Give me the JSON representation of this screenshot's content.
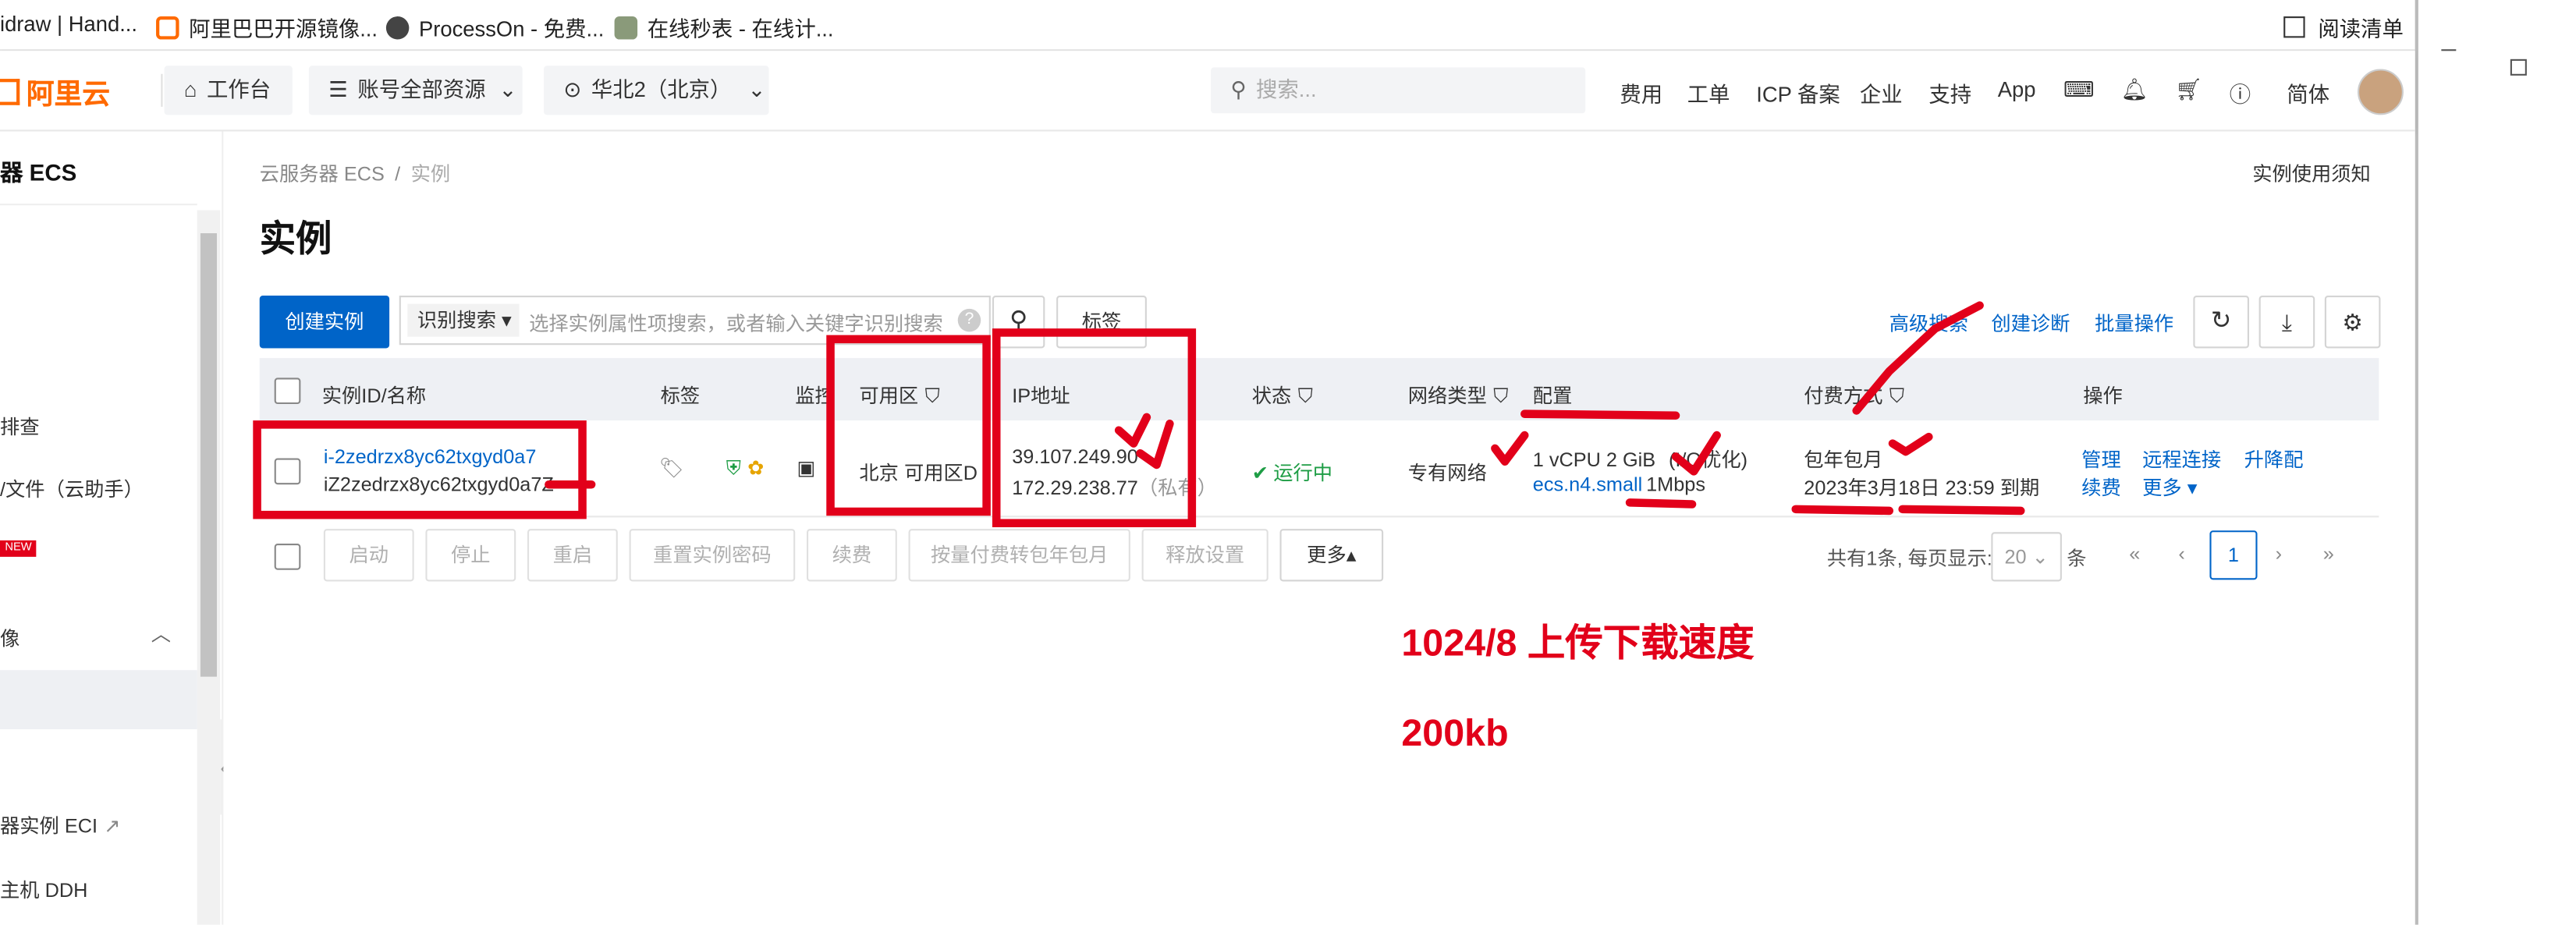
{
  "bookmarks": [
    {
      "label": "idraw | Hand...",
      "icon": "page-icon"
    },
    {
      "label": "阿里巴巴开源镜像...",
      "icon": "aliyun-logo-icon"
    },
    {
      "label": "ProcessOn - 免费...",
      "icon": "globe-icon"
    },
    {
      "label": "在线秒表 - 在线计...",
      "icon": "stopwatch-icon"
    }
  ],
  "reading_list": "阅读清单",
  "topbar": {
    "brand": "阿里云",
    "workbench": "工作台",
    "resources": "账号全部资源",
    "region": "华北2（北京）",
    "search_placeholder": "搜索...",
    "nav": [
      "费用",
      "工单",
      "ICP 备案",
      "企业",
      "支持",
      "App"
    ],
    "lang": "简体"
  },
  "sidebar": {
    "title": "器 ECS",
    "items": [
      "排查",
      "/文件（云助手）",
      "像",
      "器实例 ECI",
      "主机 DDH"
    ],
    "new_badge": "NEW"
  },
  "breadcrumb": [
    "云服务器 ECS",
    "/",
    "实例"
  ],
  "notice_link": "实例使用须知",
  "page_title": "实例",
  "toolbar": {
    "create": "创建实例",
    "search_type": "识别搜索",
    "search_placeholder": "选择实例属性项搜索，或者输入关键字识别搜索",
    "tag": "标签",
    "advanced": "高级搜索",
    "diagnose": "创建诊断",
    "batch": "批量操作"
  },
  "table": {
    "headers": [
      "实例ID/名称",
      "标签",
      "监控",
      "可用区",
      "IP地址",
      "状态",
      "网络类型",
      "配置",
      "付费方式",
      "操作"
    ],
    "row": {
      "id": "i-2zedrzx8yc62txgyd0a7",
      "name": "iZ2zedrzx8yc62txgyd0a7Z",
      "zone": "北京 可用区D",
      "ip_public": "39.107.249.90",
      "ip_private": "172.29.238.77",
      "ip_private_suffix": "（私有）",
      "status": "运行中",
      "network": "专有网络",
      "config_spec": "1 vCPU 2 GiB",
      "config_io": "(I/O优化)",
      "config_type": "ecs.n4.small",
      "config_bw": "1Mbps",
      "billing": "包年包月",
      "expire": "2023年3月18日 23:59 到期",
      "ops": [
        "管理",
        "远程连接",
        "升降配",
        "续费",
        "更多"
      ]
    }
  },
  "footer": {
    "actions": [
      "启动",
      "停止",
      "重启",
      "重置实例密码",
      "续费",
      "按量付费转包年包月",
      "释放设置",
      "更多"
    ],
    "total": "共有1条, 每页显示:",
    "page_size": "20",
    "unit": "条",
    "page": "1"
  },
  "annotations": [
    "1024/8 上传下载速度",
    "200kb"
  ],
  "colors": {
    "accent": "#0064c8",
    "brand": "#ff6a00",
    "annotation": "#e2001a",
    "running": "#1e9d45"
  }
}
